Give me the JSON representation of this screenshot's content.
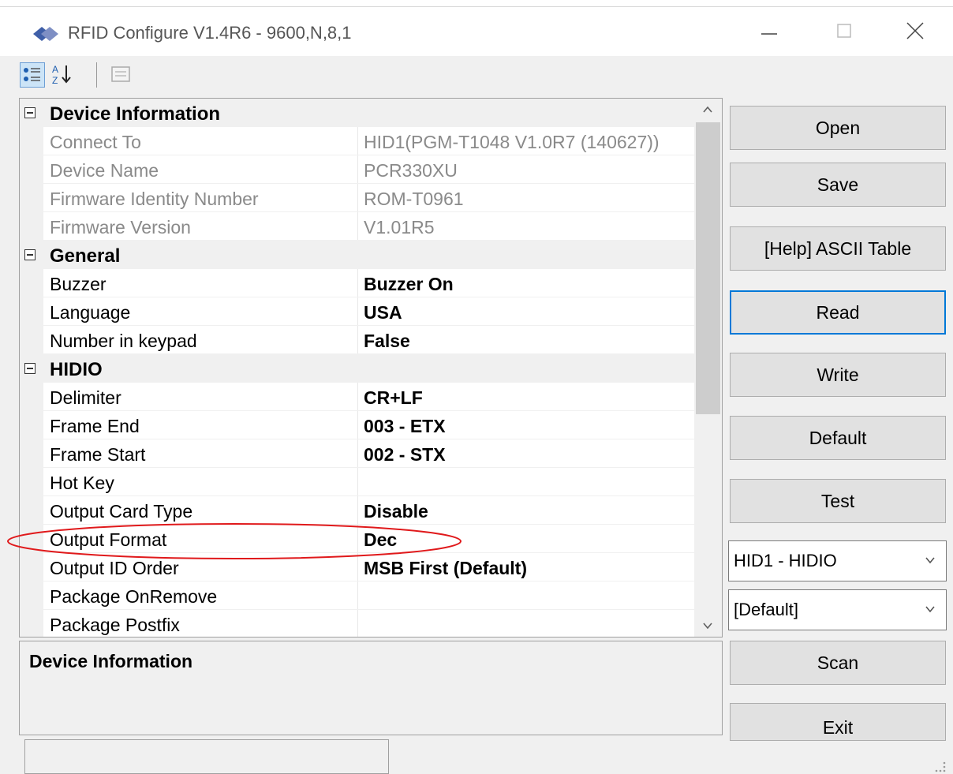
{
  "window": {
    "title": "RFID Configure V1.4R6 - 9600,N,8,1"
  },
  "toolbar": {
    "buttons": [
      {
        "name": "categorized",
        "icon": "categorized-view-icon",
        "active": true
      },
      {
        "name": "alphabetical",
        "icon": "sort-alphabetical-icon",
        "active": false
      },
      {
        "name": "property-pages",
        "icon": "property-pages-icon",
        "active": false
      }
    ]
  },
  "grid": {
    "rows": [
      {
        "type": "category",
        "label": "Device Information"
      },
      {
        "type": "property",
        "name": "Connect To",
        "value": "HID1(PGM-T1048 V1.0R7 (140627))",
        "readonly": true
      },
      {
        "type": "property",
        "name": "Device Name",
        "value": "PCR330XU",
        "readonly": true
      },
      {
        "type": "property",
        "name": "Firmware Identity Number",
        "value": "ROM-T0961",
        "readonly": true
      },
      {
        "type": "property",
        "name": "Firmware Version",
        "value": "V1.01R5",
        "readonly": true
      },
      {
        "type": "category",
        "label": "General"
      },
      {
        "type": "property",
        "name": "Buzzer",
        "value": "Buzzer On"
      },
      {
        "type": "property",
        "name": "Language",
        "value": "USA"
      },
      {
        "type": "property",
        "name": "Number in keypad",
        "value": "False"
      },
      {
        "type": "category",
        "label": "HIDIO"
      },
      {
        "type": "property",
        "name": "Delimiter",
        "value": "CR+LF"
      },
      {
        "type": "property",
        "name": "Frame End",
        "value": "003 - ETX"
      },
      {
        "type": "property",
        "name": "Frame Start",
        "value": "002 - STX"
      },
      {
        "type": "property",
        "name": "Hot Key",
        "value": ""
      },
      {
        "type": "property",
        "name": "Output Card Type",
        "value": "Disable"
      },
      {
        "type": "property",
        "name": "Output Format",
        "value": "Dec"
      },
      {
        "type": "property",
        "name": "Output ID Order",
        "value": "MSB First (Default)"
      },
      {
        "type": "property",
        "name": "Package OnRemove",
        "value": ""
      },
      {
        "type": "property",
        "name": "Package Postfix",
        "value": ""
      }
    ]
  },
  "description": {
    "title": "Device Information"
  },
  "buttons": {
    "open": "Open",
    "save": "Save",
    "help": "[Help] ASCII Table",
    "read": "Read",
    "write": "Write",
    "default": "Default",
    "test": "Test",
    "scan": "Scan",
    "exit": "Exit"
  },
  "combos": {
    "device": "HID1 - HIDIO",
    "profile": "[Default]"
  },
  "colors": {
    "accent": "#0078d7",
    "annotation": "#e0191b"
  }
}
